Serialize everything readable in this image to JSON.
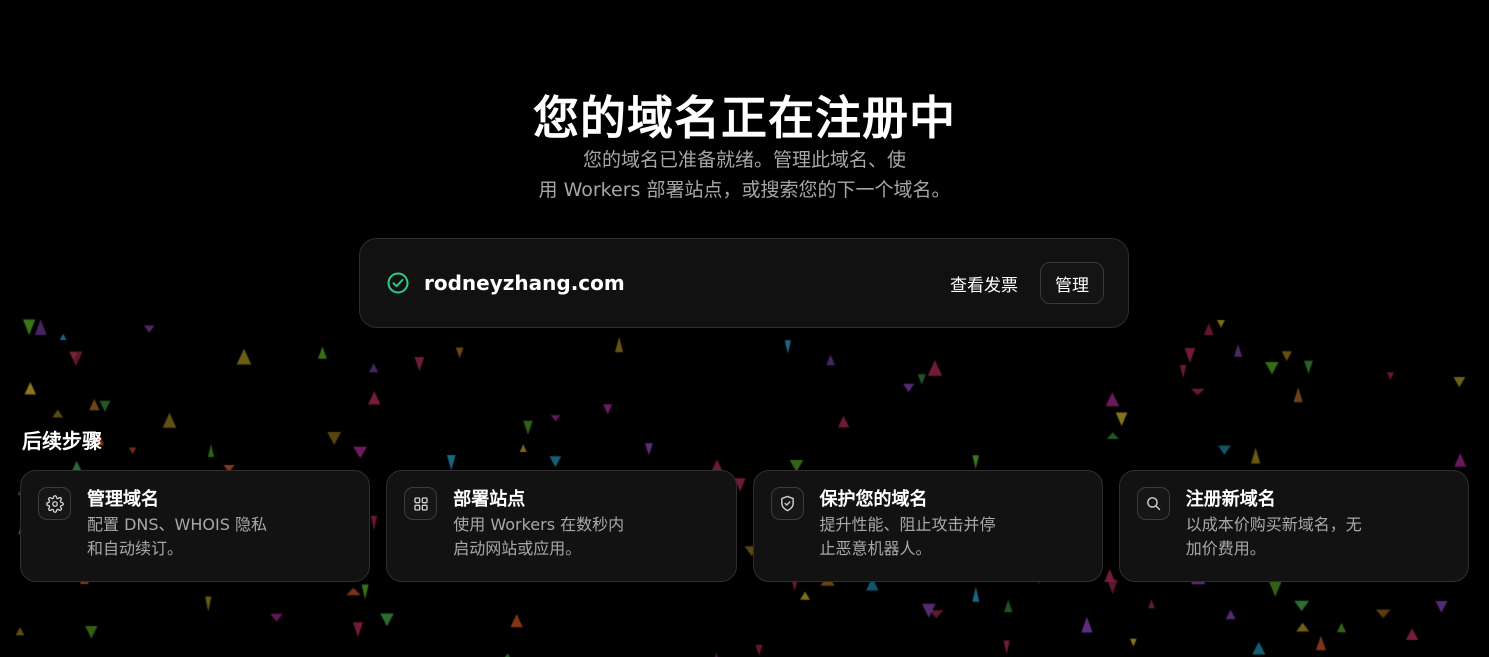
{
  "hero": {
    "title": "您的域名正在注册中",
    "subtitle_line1": "您的域名已准备就绪。管理此域名、使",
    "subtitle_line2": "用 Workers 部署站点，或搜索您的下一个域名。"
  },
  "domain_card": {
    "status_icon": "check-circle-icon",
    "domain": "rodneyzhang.com",
    "invoice_label": "查看发票",
    "manage_label": "管理"
  },
  "next_steps": {
    "title": "后续步骤",
    "items": [
      {
        "icon": "gear-icon",
        "title": "管理域名",
        "description": "配置 DNS、WHOIS 隐私和自动续订。"
      },
      {
        "icon": "grid-icon",
        "title": "部署站点",
        "description": "使用 Workers 在数秒内启动网站或应用。"
      },
      {
        "icon": "shield-icon",
        "title": "保护您的域名",
        "description": "提升性能、阻止攻击并停止恶意机器人。"
      },
      {
        "icon": "search-icon",
        "title": "注册新域名",
        "description": "以成本价购买新域名，无加价费用。"
      }
    ]
  },
  "colors": {
    "background": "#000000",
    "card": "#121212",
    "success": "#2ecc8a",
    "muted_text": "#a6a6a6"
  }
}
